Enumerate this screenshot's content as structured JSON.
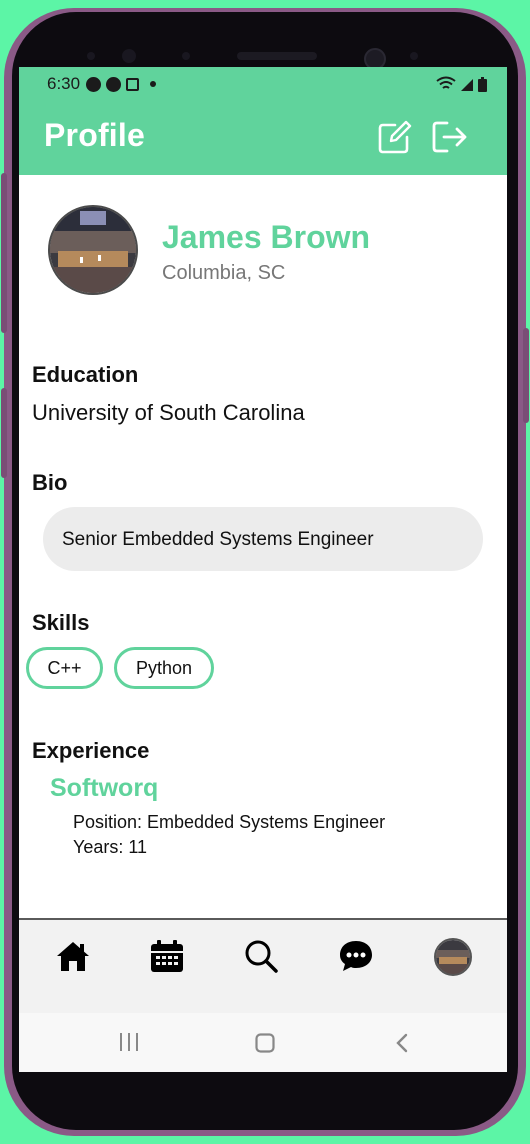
{
  "status_bar": {
    "time": "6:30",
    "icons": [
      "android-auto-icon",
      "messenger-icon",
      "news-icon",
      "dot-icon",
      "wifi-icon",
      "signal-icon",
      "battery-icon"
    ]
  },
  "header": {
    "title": "Profile",
    "background": "#60d39c",
    "actions": [
      "edit-icon",
      "logout-icon"
    ]
  },
  "profile": {
    "name": "James Brown",
    "location": "Columbia, SC"
  },
  "education": {
    "label": "Education",
    "value": "University of South Carolina"
  },
  "bio": {
    "label": "Bio",
    "value": "Senior Embedded Systems Engineer"
  },
  "skills": {
    "label": "Skills",
    "items": [
      "C++",
      "Python"
    ]
  },
  "experience": {
    "label": "Experience",
    "company": "Softworq",
    "position": "Position: Embedded Systems Engineer",
    "years": "Years: 11"
  },
  "tabbar": {
    "tabs": [
      "home-icon",
      "calendar-icon",
      "search-icon",
      "chat-icon",
      "avatar"
    ]
  },
  "system_nav": [
    "recents-button",
    "home-button",
    "back-button"
  ],
  "colors": {
    "accent": "#60d39c",
    "background": "#5cf5a6",
    "bio_fill": "#ececec"
  }
}
